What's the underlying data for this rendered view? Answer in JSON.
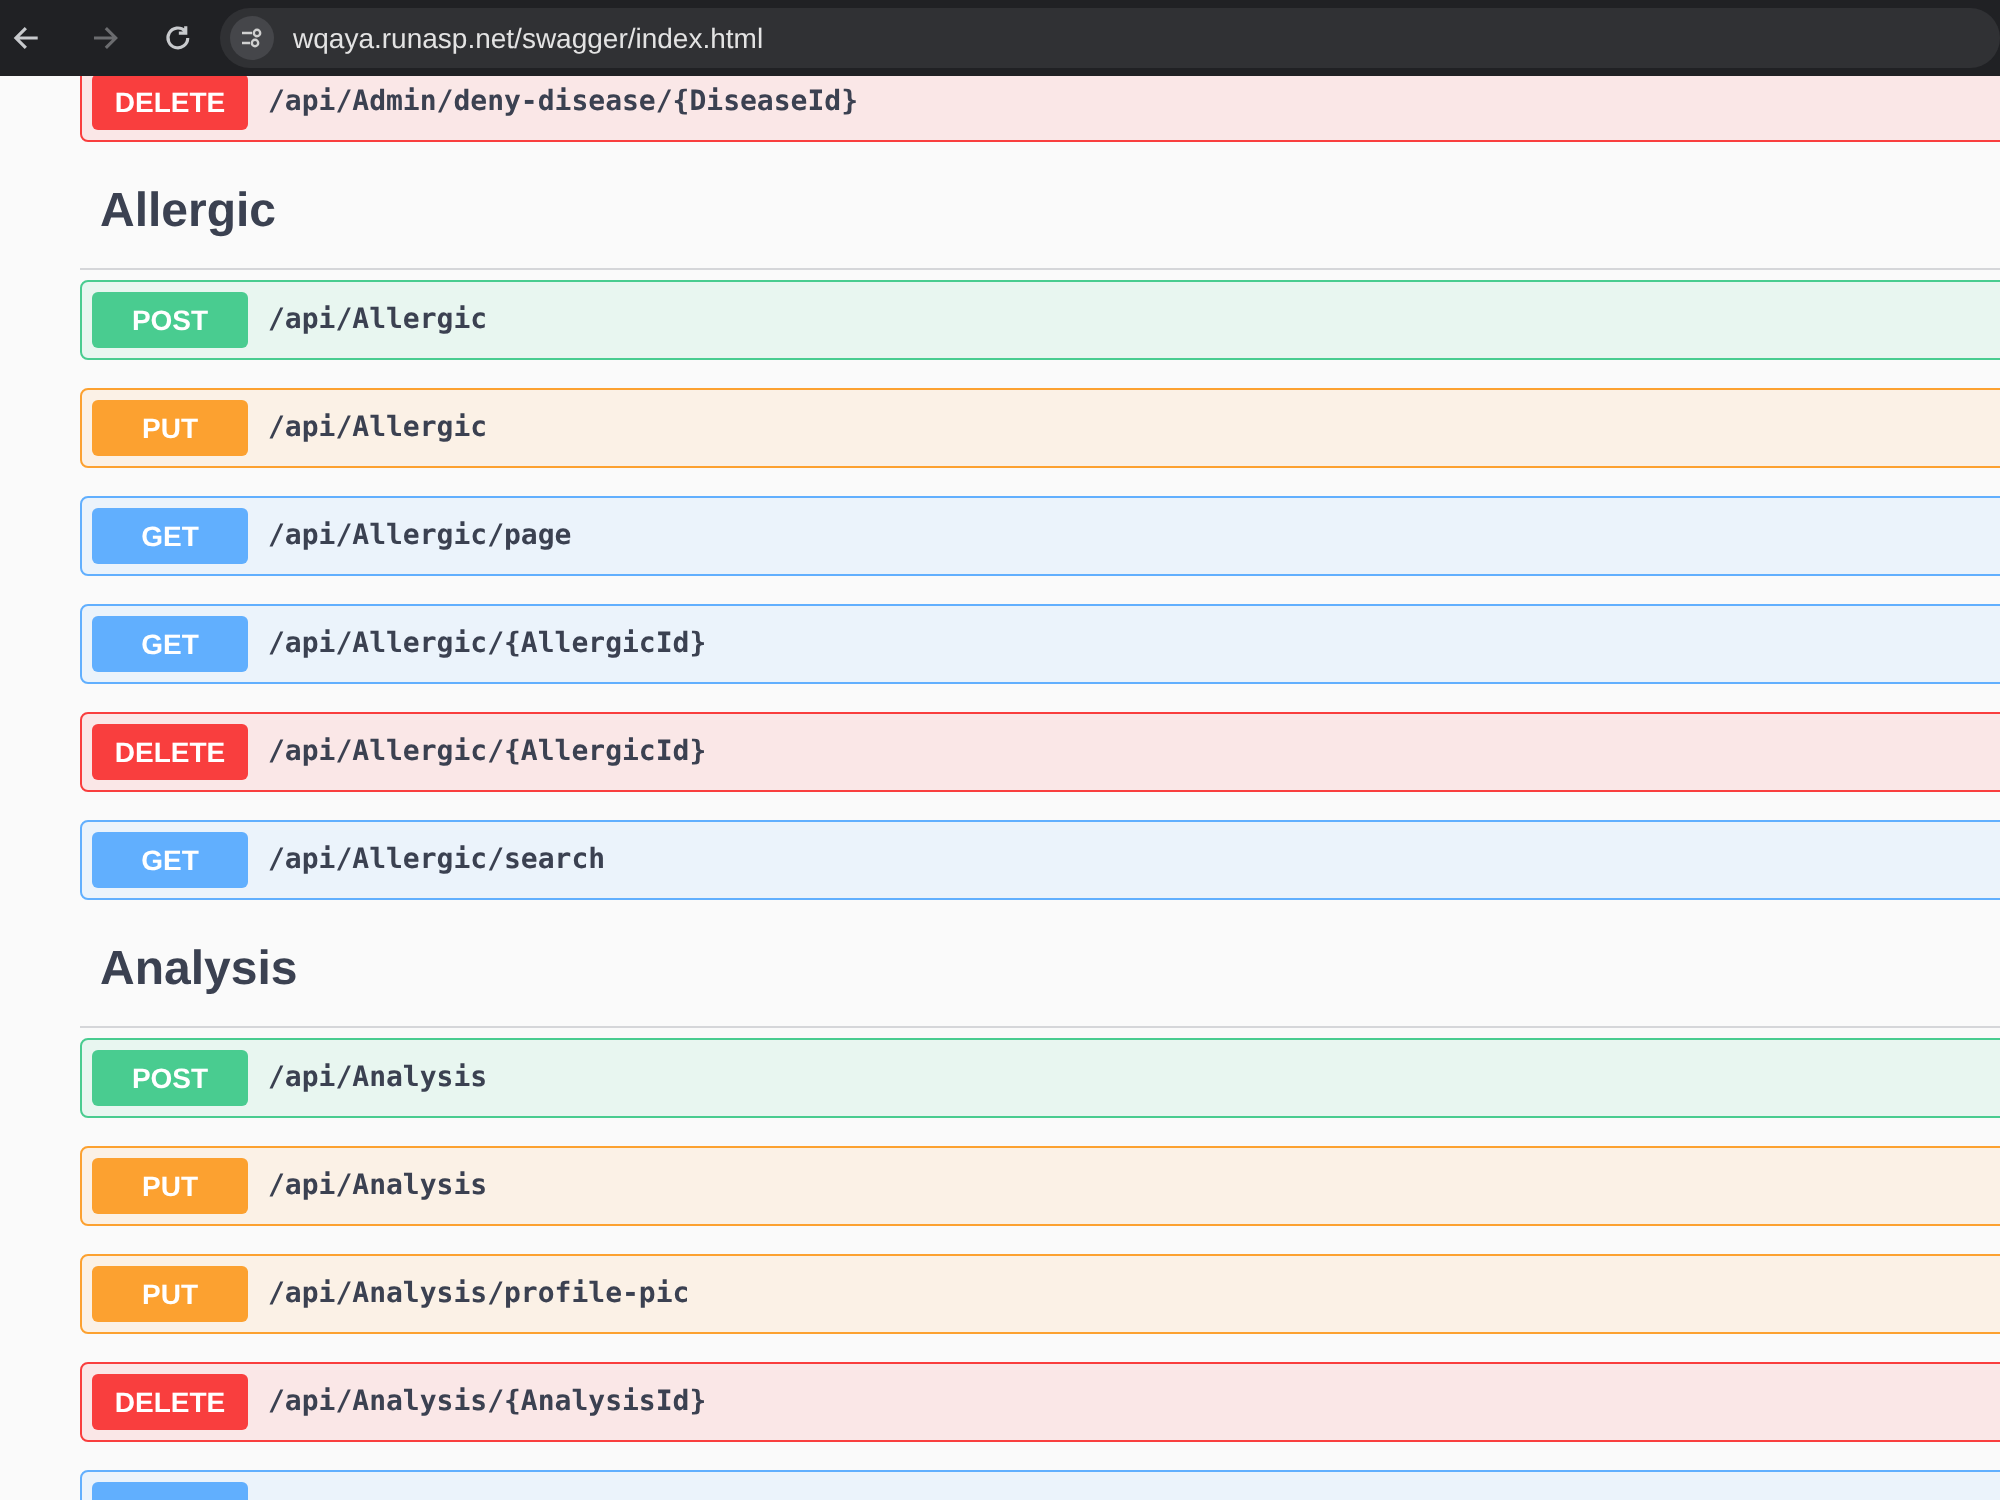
{
  "browser": {
    "url": "wqaya.runasp.net/swagger/index.html",
    "forward_disabled": true
  },
  "sections": [
    {
      "operations": [
        {
          "method": "DELETE",
          "path": "/api/Admin/deny-disease/{DiseaseId}"
        }
      ]
    },
    {
      "title": "Allergic",
      "operations": [
        {
          "method": "POST",
          "path": "/api/Allergic"
        },
        {
          "method": "PUT",
          "path": "/api/Allergic"
        },
        {
          "method": "GET",
          "path": "/api/Allergic/page"
        },
        {
          "method": "GET",
          "path": "/api/Allergic/{AllergicId}"
        },
        {
          "method": "DELETE",
          "path": "/api/Allergic/{AllergicId}"
        },
        {
          "method": "GET",
          "path": "/api/Allergic/search"
        }
      ]
    },
    {
      "title": "Analysis",
      "operations": [
        {
          "method": "POST",
          "path": "/api/Analysis"
        },
        {
          "method": "PUT",
          "path": "/api/Analysis"
        },
        {
          "method": "PUT",
          "path": "/api/Analysis/profile-pic"
        },
        {
          "method": "DELETE",
          "path": "/api/Analysis/{AnalysisId}"
        },
        {
          "color": "#61affe"
        }
      ]
    }
  ]
}
